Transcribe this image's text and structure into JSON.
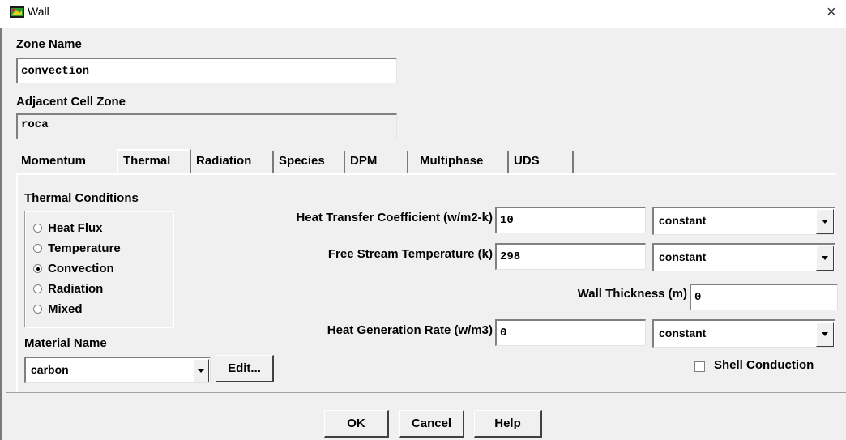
{
  "window": {
    "title": "Wall",
    "close_glyph": "×"
  },
  "zone_name": {
    "label": "Zone Name",
    "value": "convection"
  },
  "adjacent_cell_zone": {
    "label": "Adjacent Cell Zone",
    "value": "roca"
  },
  "tabs": [
    {
      "label": "Momentum",
      "active": false
    },
    {
      "label": "Thermal",
      "active": true
    },
    {
      "label": "Radiation",
      "active": false
    },
    {
      "label": "Species",
      "active": false
    },
    {
      "label": "DPM",
      "active": false
    },
    {
      "label": "Multiphase",
      "active": false
    },
    {
      "label": "UDS",
      "active": false
    }
  ],
  "thermal_conditions": {
    "label": "Thermal Conditions",
    "options": [
      {
        "label": "Heat Flux",
        "selected": false
      },
      {
        "label": "Temperature",
        "selected": false
      },
      {
        "label": "Convection",
        "selected": true
      },
      {
        "label": "Radiation",
        "selected": false
      },
      {
        "label": "Mixed",
        "selected": false
      }
    ]
  },
  "heat_transfer_coefficient": {
    "label": "Heat Transfer Coefficient (w/m2-k)",
    "value": "10",
    "method": "constant"
  },
  "free_stream_temperature": {
    "label": "Free Stream Temperature (k)",
    "value": "298",
    "method": "constant"
  },
  "wall_thickness": {
    "label": "Wall Thickness (m)",
    "value": "0"
  },
  "heat_generation_rate": {
    "label": "Heat Generation Rate (w/m3)",
    "value": "0",
    "method": "constant"
  },
  "material": {
    "label": "Material Name",
    "value": "carbon",
    "edit_label": "Edit..."
  },
  "shell_conduction": {
    "label": "Shell Conduction",
    "checked": false
  },
  "buttons": {
    "ok": "OK",
    "cancel": "Cancel",
    "help": "Help"
  },
  "icons": {
    "app": "fluent-app-icon",
    "close": "close-icon",
    "dropdown": "chevron-down-icon"
  }
}
